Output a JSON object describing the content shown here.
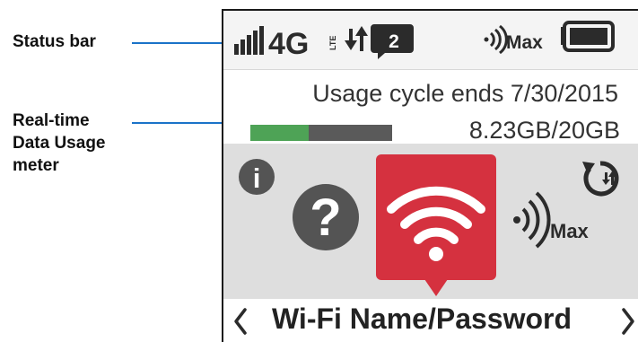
{
  "callouts": {
    "status_bar": "Status bar",
    "meter_line1": "Real-time",
    "meter_line2": "Data Usage",
    "meter_line3": "meter"
  },
  "status": {
    "network": "4G",
    "lte": "LTE",
    "connected_devices": "2",
    "wifi_range": "Max",
    "signal_bars": 5,
    "battery_level": 1.0,
    "icons": [
      "signal-bars-icon",
      "data-transfer-icon",
      "device-count-icon",
      "wifi-range-icon",
      "battery-icon"
    ]
  },
  "usage": {
    "cycle_text": "Usage cycle ends 7/30/2015",
    "amount_text": "8.23GB/20GB",
    "used_gb": 8.23,
    "total_gb": 20,
    "meter_color": "#4ea356",
    "meter_track_color": "#5a5a5a"
  },
  "carousel": {
    "range_label": "Max",
    "selected_label": "Wi-Fi Name/Password",
    "accent_color": "#d5313f",
    "icons": [
      "info-icon",
      "help-icon",
      "wifi-icon",
      "wifi-range-icon",
      "data-transfer-icon"
    ]
  }
}
